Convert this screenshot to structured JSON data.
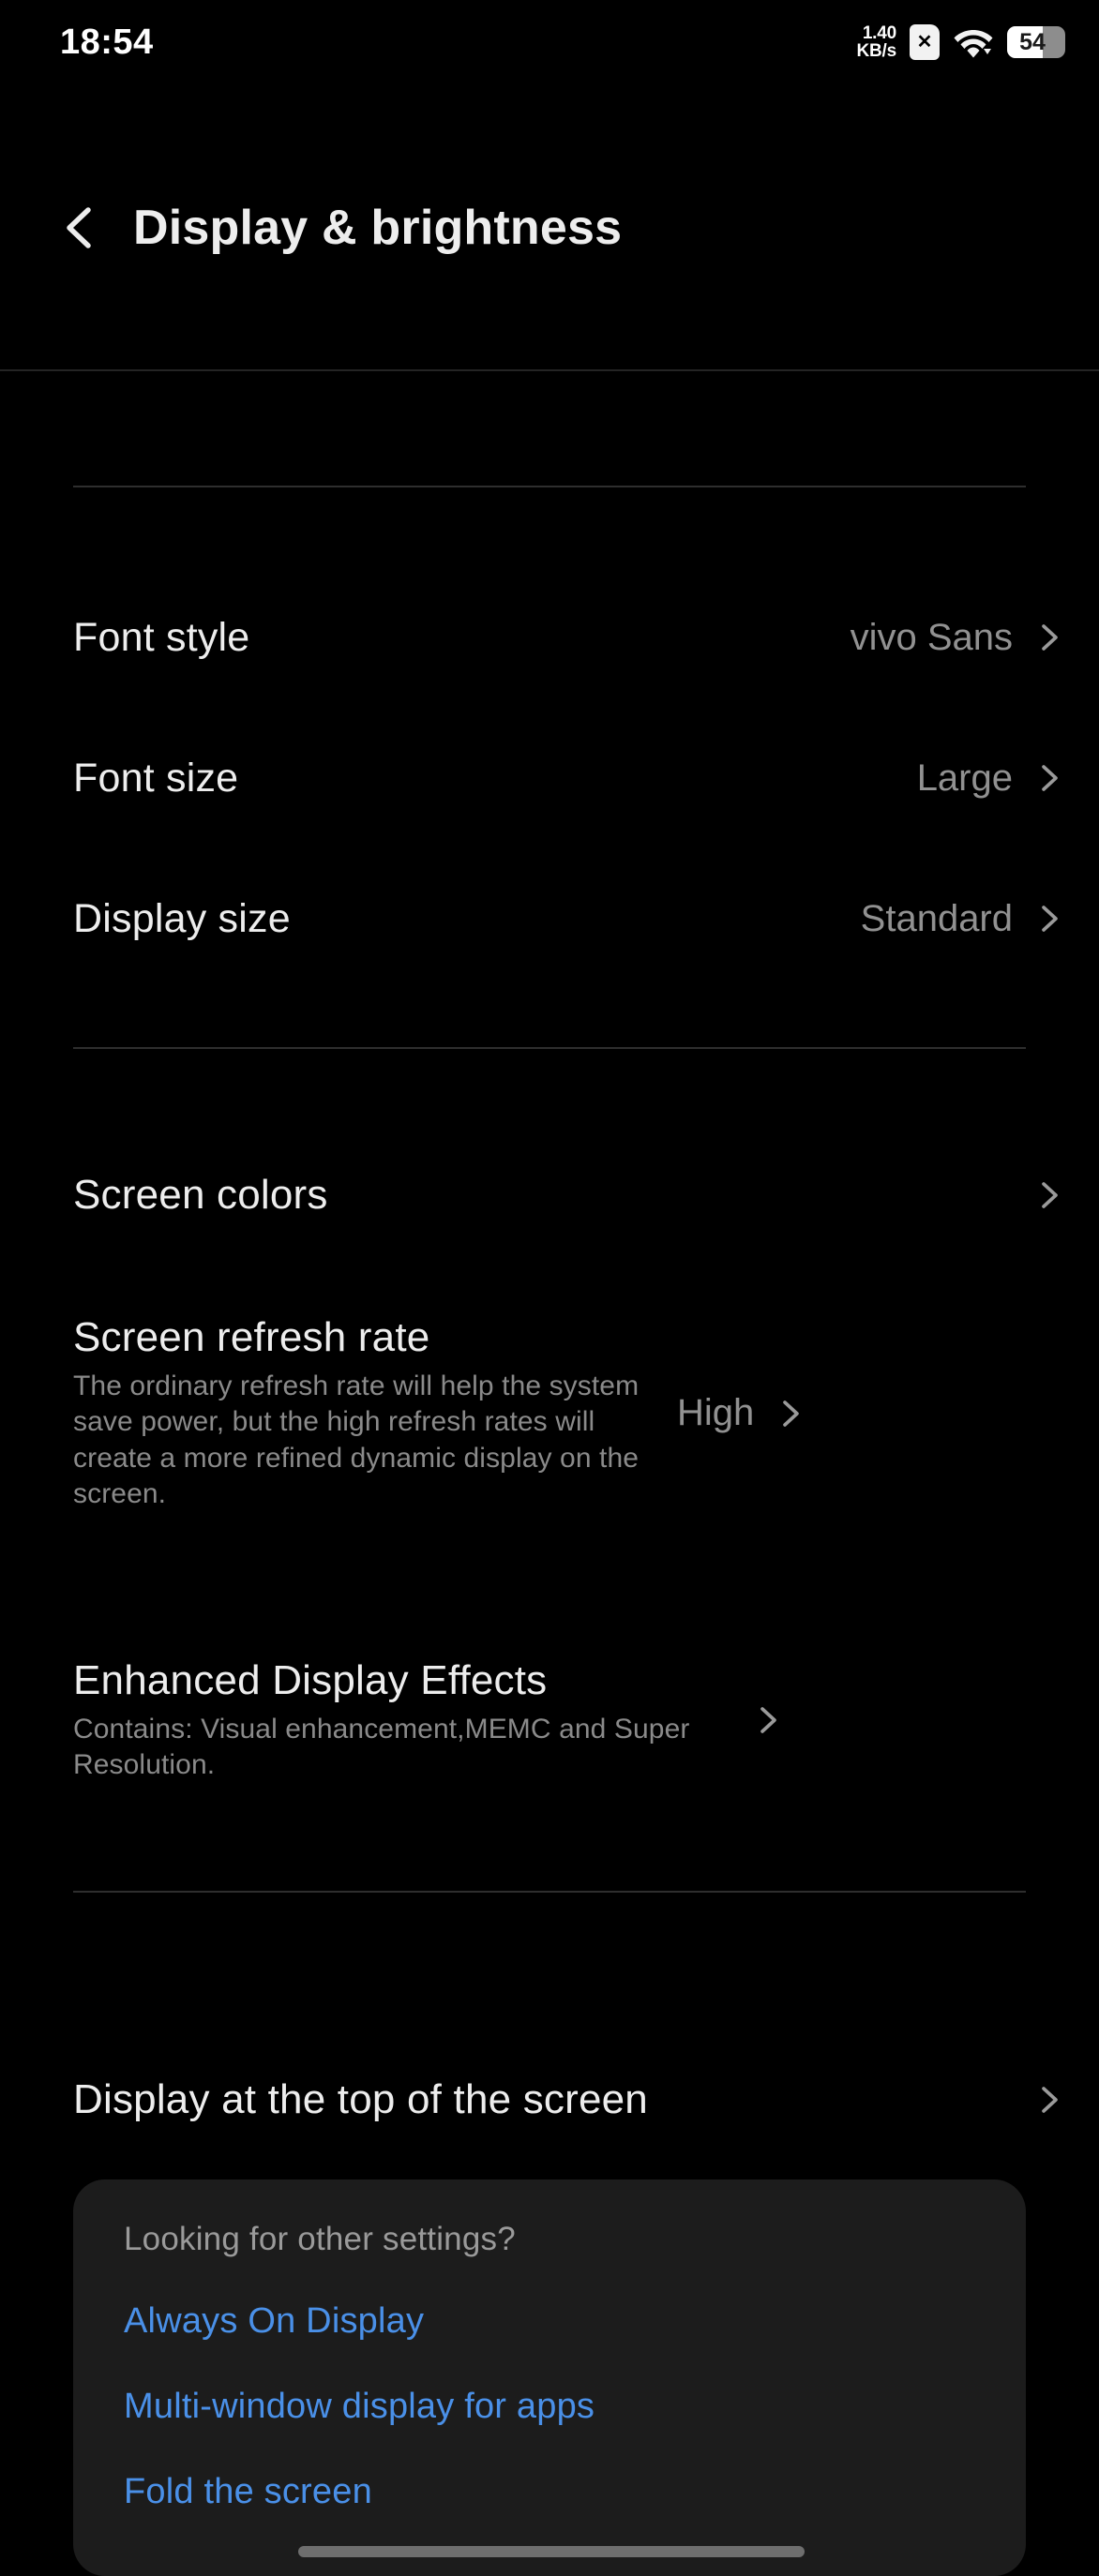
{
  "status_bar": {
    "time": "18:54",
    "network_speed_value": "1.40",
    "network_speed_unit": "KB/s",
    "sim_icon": "sim-card-x-icon",
    "wifi_icon": "wifi-icon",
    "battery_level": "54"
  },
  "header": {
    "back_icon": "back-chevron-icon",
    "title": "Display & brightness"
  },
  "sections": {
    "typography": [
      {
        "title": "Font style",
        "value": "vivo Sans"
      },
      {
        "title": "Font size",
        "value": "Large"
      },
      {
        "title": "Display size",
        "value": "Standard"
      }
    ],
    "screen": [
      {
        "title": "Screen colors",
        "value": "",
        "desc": ""
      },
      {
        "title": "Screen refresh rate",
        "value": "High",
        "desc": "The ordinary refresh rate will help the system save power, but the high refresh rates will create a more refined dynamic display on the screen."
      },
      {
        "title": "Enhanced Display Effects",
        "value": "",
        "desc": "Contains: Visual enhancement,MEMC and Super Resolution."
      }
    ],
    "misc": [
      {
        "title": "Display at the top of the screen",
        "value": ""
      }
    ]
  },
  "footer_card": {
    "title": "Looking for other settings?",
    "links": [
      "Always On Display",
      "Multi-window display for apps",
      "Fold the screen"
    ]
  },
  "colors": {
    "background": "#000000",
    "card_background": "#1c1c1c",
    "primary_text": "#ededed",
    "secondary_text": "#8a8a8a",
    "value_text": "#919191",
    "link_blue": "#4a90e8",
    "divider": "#2e2e2e"
  }
}
